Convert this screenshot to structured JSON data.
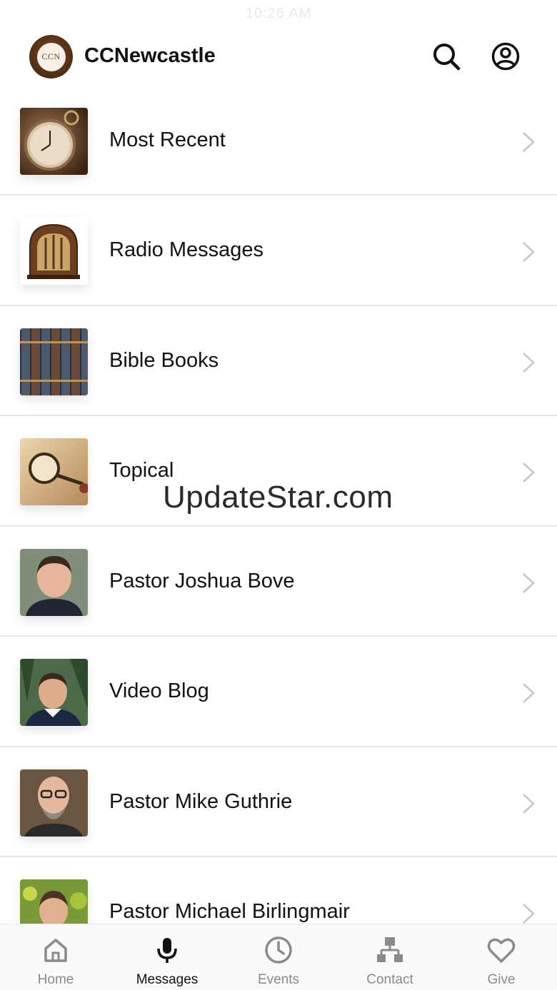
{
  "status_bar": {
    "time": "10:26 AM"
  },
  "header": {
    "logo_text": "CCN",
    "title": "CCNewcastle"
  },
  "list": [
    {
      "label": "Most Recent"
    },
    {
      "label": "Radio Messages"
    },
    {
      "label": "Bible Books"
    },
    {
      "label": "Topical"
    },
    {
      "label": "Pastor Joshua Bove"
    },
    {
      "label": "Video Blog"
    },
    {
      "label": "Pastor Mike Guthrie"
    },
    {
      "label": "Pastor Michael Birlingmair"
    }
  ],
  "watermark": "UpdateStar.com",
  "tabs": [
    {
      "label": "Home",
      "icon": "home-icon",
      "active": false
    },
    {
      "label": "Messages",
      "icon": "microphone-icon",
      "active": true
    },
    {
      "label": "Events",
      "icon": "clock-icon",
      "active": false
    },
    {
      "label": "Contact",
      "icon": "org-chart-icon",
      "active": false
    },
    {
      "label": "Give",
      "icon": "heart-icon",
      "active": false
    }
  ],
  "colors": {
    "active_tab": "#111111",
    "inactive_tab": "#8a8a8a",
    "divider": "#e7e7e7"
  }
}
